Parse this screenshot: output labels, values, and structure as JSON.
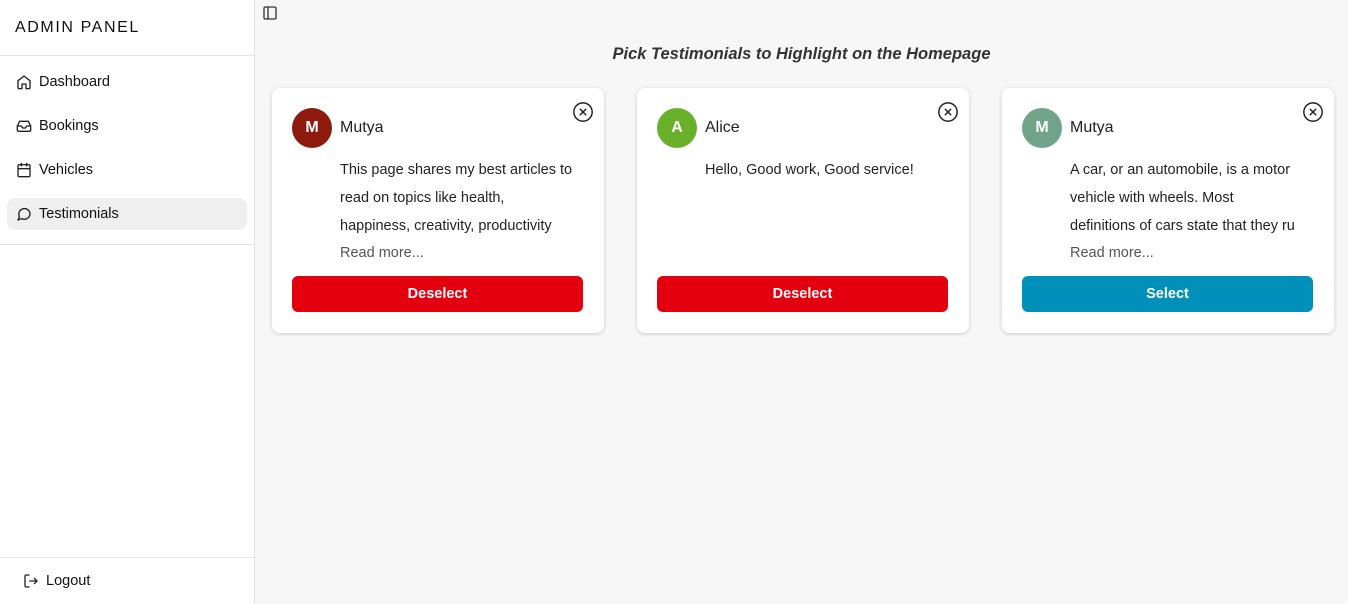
{
  "sidebar": {
    "brand": "ADMIN PANEL",
    "items": [
      {
        "label": "Dashboard",
        "icon": "home-icon",
        "active": false
      },
      {
        "label": "Bookings",
        "icon": "inbox-icon",
        "active": false
      },
      {
        "label": "Vehicles",
        "icon": "calendar-icon",
        "active": false
      },
      {
        "label": "Testimonials",
        "icon": "message-circle-icon",
        "active": true
      }
    ],
    "logout": "Logout"
  },
  "main": {
    "title": "Pick Testimonials to Highlight on the Homepage",
    "cards": [
      {
        "initial": "M",
        "avatar_color": "#8e1a0e",
        "name": "Mutya",
        "lines": [
          "This page shares my best articles to",
          "read on topics like health,",
          "happiness, creativity, productivity"
        ],
        "read_more": "Read more...",
        "button": "Deselect",
        "button_color": "#e3000f"
      },
      {
        "initial": "A",
        "avatar_color": "#6ab12b",
        "name": "Alice",
        "lines": [
          "Hello, Good work, Good service!",
          "",
          ""
        ],
        "read_more": "",
        "button": "Deselect",
        "button_color": "#e3000f"
      },
      {
        "initial": "M",
        "avatar_color": "#6fa48a",
        "name": "Mutya",
        "lines": [
          "A car, or an automobile, is a motor",
          "vehicle with wheels. Most",
          "definitions of cars state that they ru"
        ],
        "read_more": "Read more...",
        "button": "Select",
        "button_color": "#0090b9"
      }
    ]
  }
}
